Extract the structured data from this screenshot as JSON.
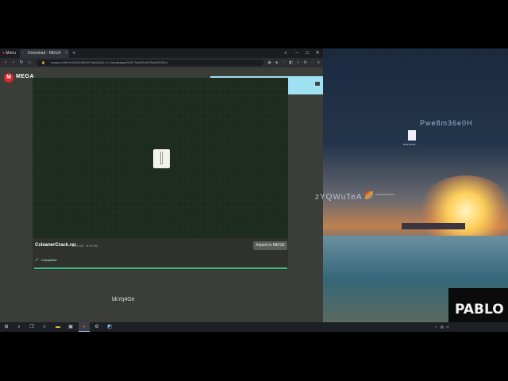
{
  "browser": {
    "tabs": {
      "menu_label": "Menu",
      "active_label": "Download - MEGA",
      "new_tab": "+"
    },
    "window_controls": {
      "minimize": "–",
      "maximize": "□",
      "close": "✕"
    },
    "address_bar": {
      "url": "mega.nz/file/Vq7AAKMI#dVYp6sWyQ_f>-Udegfsagye9d3C7tdaF6ekFZMqG9GNrd",
      "icons": [
        "back-icon",
        "forward-icon",
        "reload-icon",
        "home-icon",
        "lock-icon",
        "camera-icon",
        "extension-icon",
        "heart-icon",
        "download-icon",
        "settings-icon",
        "menu-icon"
      ]
    }
  },
  "mega": {
    "logo_letter": "M",
    "brand": "MEGA",
    "download_panel": {
      "file": "Ccleaner Crack.rar",
      "status": "Scannen computer"
    },
    "file": {
      "name": "CcleanerCrack.rar",
      "size": "8.99 KB  ·  8.99 KB",
      "import_label": "Import to MEGA",
      "status": "Completed",
      "progress": 1.0
    }
  },
  "overlay_text": {
    "below_player": "bkYq4Ge",
    "desktop_top": "Pwe8m36e0H",
    "desktop_mid": "zYQWuTeA"
  },
  "desktop": {
    "txt_file_label": "New Text D...",
    "rar_file_label": "CcleanerCrack.rar",
    "badge": "PABLO"
  },
  "taskbar": {
    "items": [
      "start-icon",
      "search-icon",
      "task-view-icon",
      "edge-icon",
      "file-explorer-icon",
      "store-icon",
      "opera-icon",
      "settings-icon",
      "app-icon"
    ],
    "tray": [
      "up-icon",
      "network-icon",
      "volume-icon"
    ]
  },
  "colors": {
    "mega_red": "#d9272e",
    "panel_blue": "#9ee1f2",
    "progress_green": "#3fc08a",
    "page_bg": "#3b3e38"
  }
}
